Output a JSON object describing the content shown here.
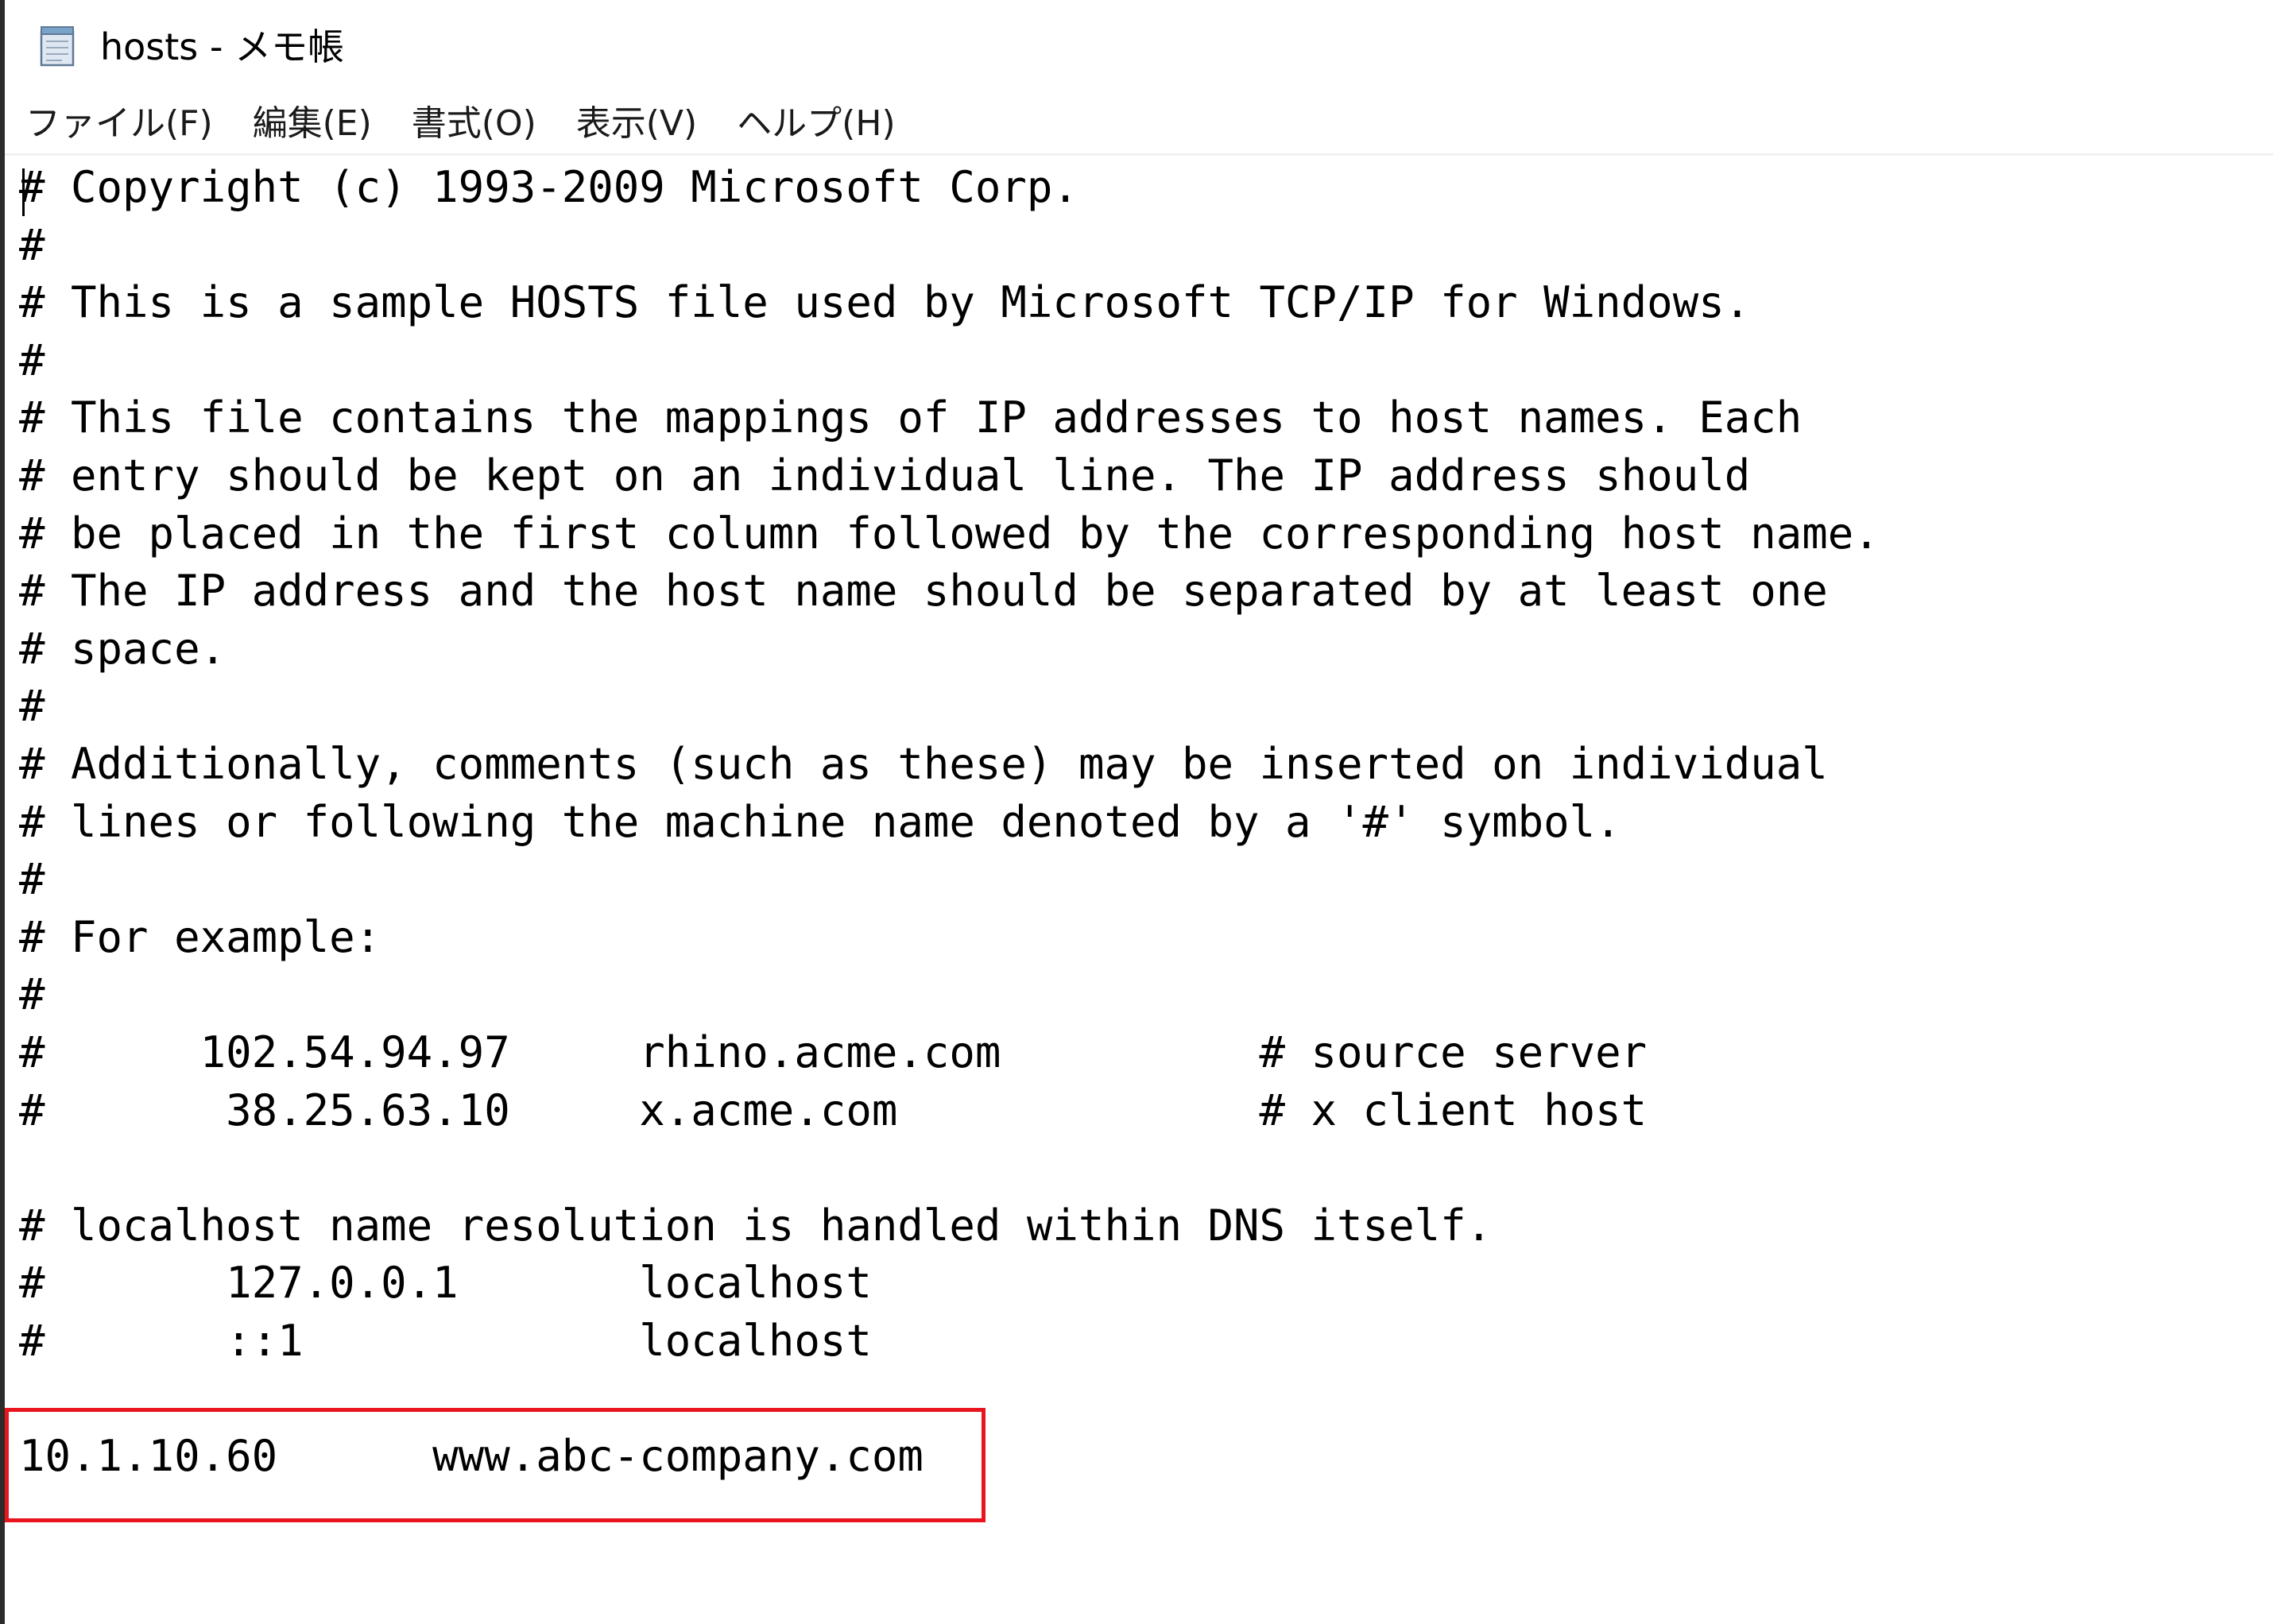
{
  "window": {
    "title": "hosts - メモ帳",
    "icon": "notepad-icon"
  },
  "menubar": {
    "items": [
      {
        "label": "ファイル(F)"
      },
      {
        "label": "編集(E)"
      },
      {
        "label": "書式(O)"
      },
      {
        "label": "表示(V)"
      },
      {
        "label": "ヘルプ(H)"
      }
    ]
  },
  "editor": {
    "content": "# Copyright (c) 1993-2009 Microsoft Corp.\n#\n# This is a sample HOSTS file used by Microsoft TCP/IP for Windows.\n#\n# This file contains the mappings of IP addresses to host names. Each\n# entry should be kept on an individual line. The IP address should\n# be placed in the first column followed by the corresponding host name.\n# The IP address and the host name should be separated by at least one\n# space.\n#\n# Additionally, comments (such as these) may be inserted on individual\n# lines or following the machine name denoted by a '#' symbol.\n#\n# For example:\n#\n#      102.54.94.97     rhino.acme.com          # source server\n#       38.25.63.10     x.acme.com              # x client host\n\n# localhost name resolution is handled within DNS itself.\n#\t127.0.0.1       localhost\n#\t::1             localhost\n\n10.1.10.60\twww.abc-company.com",
    "highlight_color": "#e8141e"
  }
}
